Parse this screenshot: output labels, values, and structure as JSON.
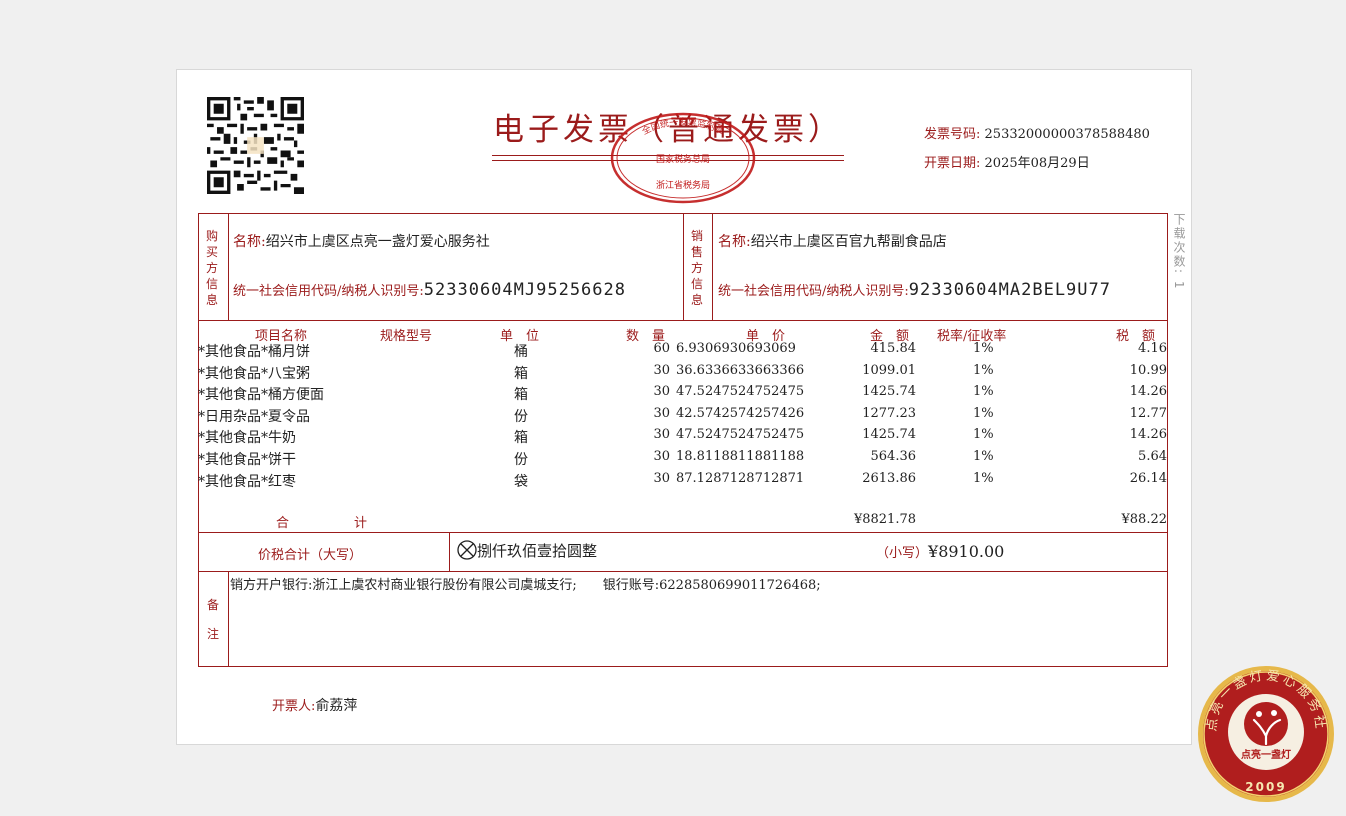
{
  "header": {
    "title": "电子发票（普通发票）",
    "invoice_no_label": "发票号码:",
    "invoice_no": "25332000000378588480",
    "date_label": "开票日期:",
    "date": "2025年08月29日",
    "download_count": "下载次数: 1",
    "stamp_top": "全国统一发票监制章",
    "stamp_mid": "国家税务总局",
    "stamp_bottom": "浙江省税务局"
  },
  "buyer": {
    "side_label": "购买方信息",
    "name_label": "名称:",
    "name": "绍兴市上虞区点亮一盏灯爱心服务社",
    "tax_label": "统一社会信用代码/纳税人识别号:",
    "tax_id": "52330604MJ95256628"
  },
  "seller": {
    "side_label": "销售方信息",
    "name_label": "名称:",
    "name": "绍兴市上虞区百官九帮副食品店",
    "tax_label": "统一社会信用代码/纳税人识别号:",
    "tax_id": "92330604MA2BEL9U77"
  },
  "table": {
    "headers": [
      "项目名称",
      "规格型号",
      "单　位",
      "数　量",
      "单　价",
      "金　额",
      "税率/征收率",
      "税　额"
    ],
    "rows": [
      {
        "name": "*其他食品*桶月饼",
        "unit": "桶",
        "qty": "60",
        "price": "6.9306930693069",
        "amount": "415.84",
        "rate": "1%",
        "tax": "4.16"
      },
      {
        "name": "*其他食品*八宝粥",
        "unit": "箱",
        "qty": "30",
        "price": "36.6336633663366",
        "amount": "1099.01",
        "rate": "1%",
        "tax": "10.99"
      },
      {
        "name": "*其他食品*桶方便面",
        "unit": "箱",
        "qty": "30",
        "price": "47.5247524752475",
        "amount": "1425.74",
        "rate": "1%",
        "tax": "14.26"
      },
      {
        "name": "*日用杂品*夏令品",
        "unit": "份",
        "qty": "30",
        "price": "42.5742574257426",
        "amount": "1277.23",
        "rate": "1%",
        "tax": "12.77"
      },
      {
        "name": "*其他食品*牛奶",
        "unit": "箱",
        "qty": "30",
        "price": "47.5247524752475",
        "amount": "1425.74",
        "rate": "1%",
        "tax": "14.26"
      },
      {
        "name": "*其他食品*饼干",
        "unit": "份",
        "qty": "30",
        "price": "18.8118811881188",
        "amount": "564.36",
        "rate": "1%",
        "tax": "5.64"
      },
      {
        "name": "*其他食品*红枣",
        "unit": "袋",
        "qty": "30",
        "price": "87.1287128712871",
        "amount": "2613.86",
        "rate": "1%",
        "tax": "26.14"
      }
    ],
    "total_label": "合　　　　　计",
    "total_amount": "¥8821.78",
    "total_tax": "¥88.22"
  },
  "grand_total": {
    "label": "价税合计（大写）",
    "uppercase": "捌仟玖佰壹拾圆整",
    "small_label": "（小写）",
    "small": "¥8910.00"
  },
  "remarks": {
    "label_1": "备",
    "label_2": "注",
    "text": "销方开户银行:浙江上虞农村商业银行股份有限公司虞城支行;　　银行账号:6228580699011726468;"
  },
  "issuer": {
    "label": "开票人:",
    "name": "俞荔萍"
  },
  "seal": {
    "ring_text": "点亮一盏灯爱心服务社",
    "center_text": "点亮一盏灯",
    "year": "2009"
  },
  "colors": {
    "accent": "#9b1b1b",
    "seal_gold": "#e6b84a"
  }
}
